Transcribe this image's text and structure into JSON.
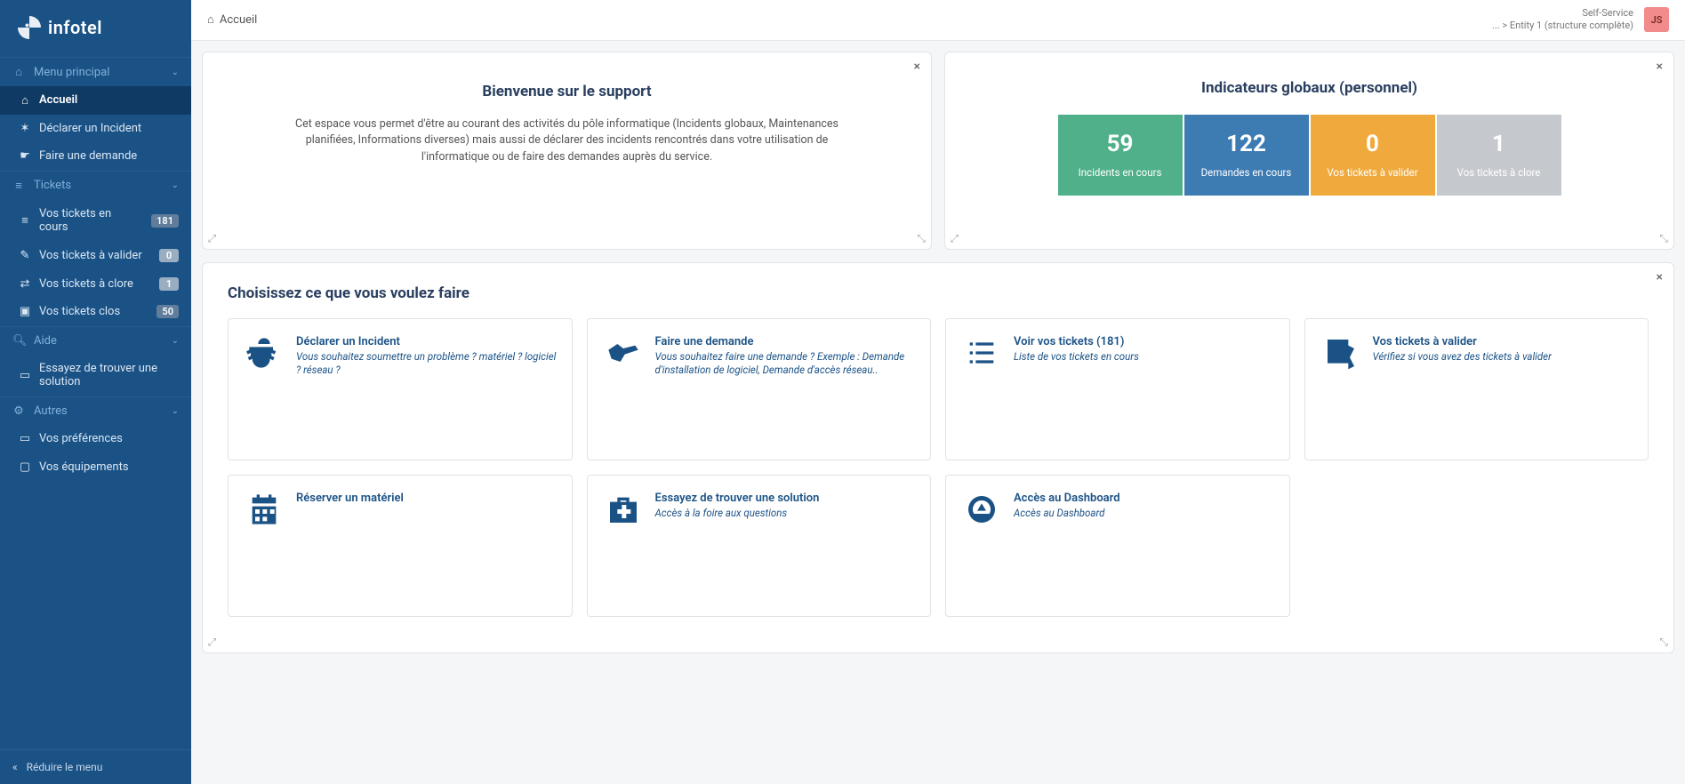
{
  "brand": "infotel",
  "sidebar": {
    "sections": {
      "main": "Menu principal",
      "tickets": "Tickets",
      "aide": "Aide",
      "autres": "Autres"
    },
    "items": {
      "accueil": "Accueil",
      "declarer": "Déclarer un Incident",
      "demande": "Faire une demande",
      "encours": {
        "label": "Vos tickets en cours",
        "badge": "181"
      },
      "valider": {
        "label": "Vos tickets à valider",
        "badge": "0"
      },
      "clore": {
        "label": "Vos tickets à clore",
        "badge": "1"
      },
      "clos": {
        "label": "Vos tickets clos",
        "badge": "50"
      },
      "solution": "Essayez de trouver une solution",
      "prefs": "Vos préférences",
      "equip": "Vos équipements"
    },
    "collapse": "Réduire le menu"
  },
  "topbar": {
    "breadcrumb": "Accueil",
    "profile_line1": "Self-Service",
    "profile_line2": "... > Entity 1 (structure complète)",
    "avatar": "JS"
  },
  "welcome": {
    "title": "Bienvenue sur le support",
    "body": "Cet espace vous permet d'être au courant des activités du pôle informatique (Incidents globaux, Maintenances planifiées, Informations diverses) mais aussi de déclarer des incidents rencontrés dans votre utilisation de l'informatique ou de faire des demandes auprès du service."
  },
  "kpi": {
    "title": "Indicateurs globaux (personnel)",
    "items": [
      {
        "value": "59",
        "label": "Incidents en cours",
        "color": "green"
      },
      {
        "value": "122",
        "label": "Demandes en cours",
        "color": "blue"
      },
      {
        "value": "0",
        "label": "Vos tickets à valider",
        "color": "orange"
      },
      {
        "value": "1",
        "label": "Vos tickets à clore",
        "color": "gray"
      }
    ]
  },
  "choose": {
    "title": "Choisissez ce que vous voulez faire",
    "tiles": [
      {
        "icon": "bug",
        "title": "Déclarer un Incident",
        "desc": "Vous souhaitez soumettre un problème ? matériel ? logiciel ? réseau ?"
      },
      {
        "icon": "hand",
        "title": "Faire une demande",
        "desc": "Vous souhaitez faire une demande ? Exemple : Demande d'installation de logiciel, Demande d'accès réseau.."
      },
      {
        "icon": "list",
        "title": "Voir vos tickets (181)",
        "desc": "Liste de vos tickets en cours"
      },
      {
        "icon": "check",
        "title": "Vos tickets à valider",
        "desc": "Vérifiez si vous avez des tickets à valider"
      },
      {
        "icon": "calendar",
        "title": "Réserver un matériel",
        "desc": ""
      },
      {
        "icon": "medkit",
        "title": "Essayez de trouver une solution",
        "desc": "Accès à la foire aux questions"
      },
      {
        "icon": "gauge",
        "title": "Accès au Dashboard",
        "desc": "Accès au Dashboard"
      }
    ]
  },
  "close_glyph": "×"
}
